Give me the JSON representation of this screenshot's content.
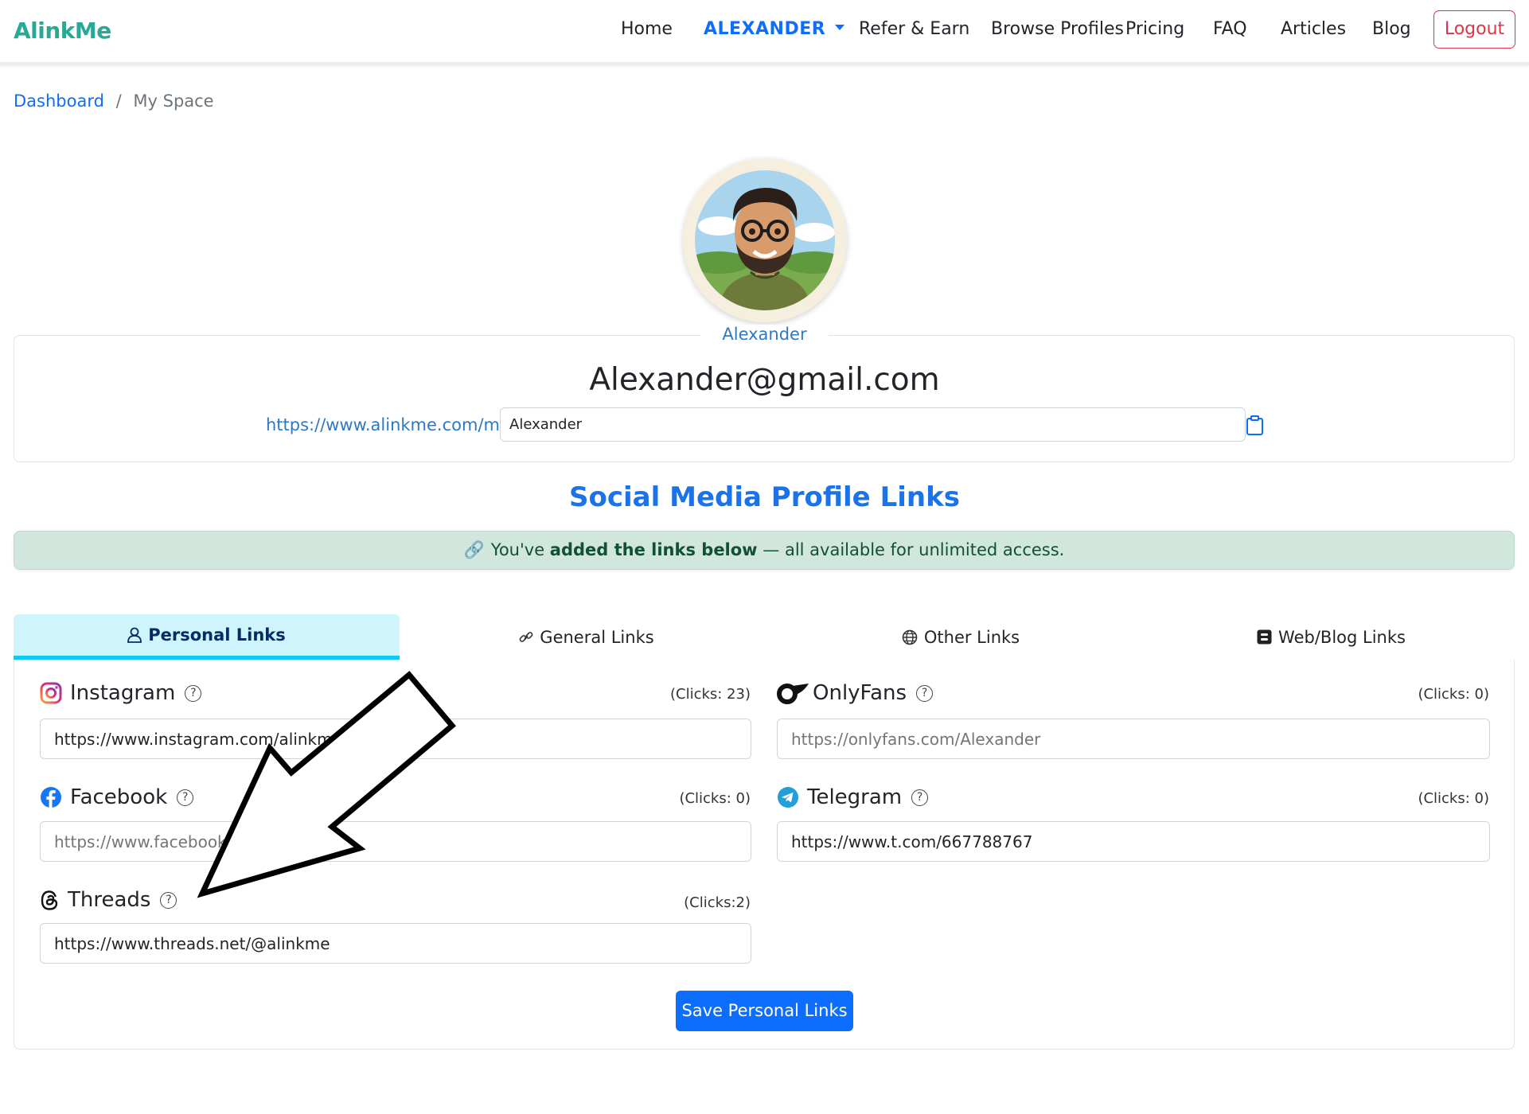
{
  "navbar": {
    "brand": "AlinkMe",
    "links": {
      "home": "Home",
      "user": "ALEXANDER",
      "refer": "Refer & Earn",
      "browse": "Browse Profiles",
      "pricing": "Pricing",
      "faq": "FAQ",
      "articles": "Articles",
      "blog": "Blog"
    },
    "logout": "Logout"
  },
  "breadcrumb": {
    "dashboard": "Dashboard",
    "separator": "/",
    "current": "My Space"
  },
  "profile": {
    "avatar_icon": "avatar-illustration",
    "display_name": "Alexander",
    "email": "Alexander@gmail.com",
    "url_prefix": "https://www.alinkme.com/me/",
    "slug": "Alexander",
    "copy_icon": "clipboard-icon"
  },
  "section": {
    "title": "Social Media Profile Links",
    "alert": {
      "icon": "link-icon",
      "before": "You've ",
      "bold": "added the links below",
      "after": " — all available for unlimited access."
    }
  },
  "tabs": [
    {
      "label": "Personal Links",
      "icon": "person-icon",
      "active": true
    },
    {
      "label": "General Links",
      "icon": "link-icon",
      "active": false
    },
    {
      "label": "Other Links",
      "icon": "globe-icon",
      "active": false
    },
    {
      "label": "Web/Blog Links",
      "icon": "blogger-icon",
      "active": false
    }
  ],
  "links": {
    "instagram": {
      "label": "Instagram",
      "help": "?",
      "clicks": "(Clicks: 23)",
      "value": "https://www.instagram.com/alinkme",
      "placeholder": ""
    },
    "onlyfans": {
      "label": "OnlyFans",
      "help": "?",
      "clicks": "(Clicks: 0)",
      "value": "",
      "placeholder": "https://onlyfans.com/Alexander"
    },
    "facebook": {
      "label": "Facebook",
      "help": "?",
      "clicks": "(Clicks: 0)",
      "value": "",
      "placeholder": "https://www.facebook.com/Alexander"
    },
    "telegram": {
      "label": "Telegram",
      "help": "?",
      "clicks": "(Clicks: 0)",
      "value": "https://www.t.com/667788767",
      "placeholder": ""
    },
    "threads": {
      "label": "Threads",
      "help": "?",
      "clicks": "(Clicks:2)",
      "value": "https://www.threads.net/@alinkme",
      "placeholder": ""
    }
  },
  "save_button": "Save Personal Links",
  "colors": {
    "brand": "#2aa893",
    "primary": "#0d6efd",
    "danger": "#dc3545",
    "alert_bg": "#d1e7dd",
    "tab_active_bg": "#cff4fc",
    "tab_active_border": "#0dcaf0"
  }
}
